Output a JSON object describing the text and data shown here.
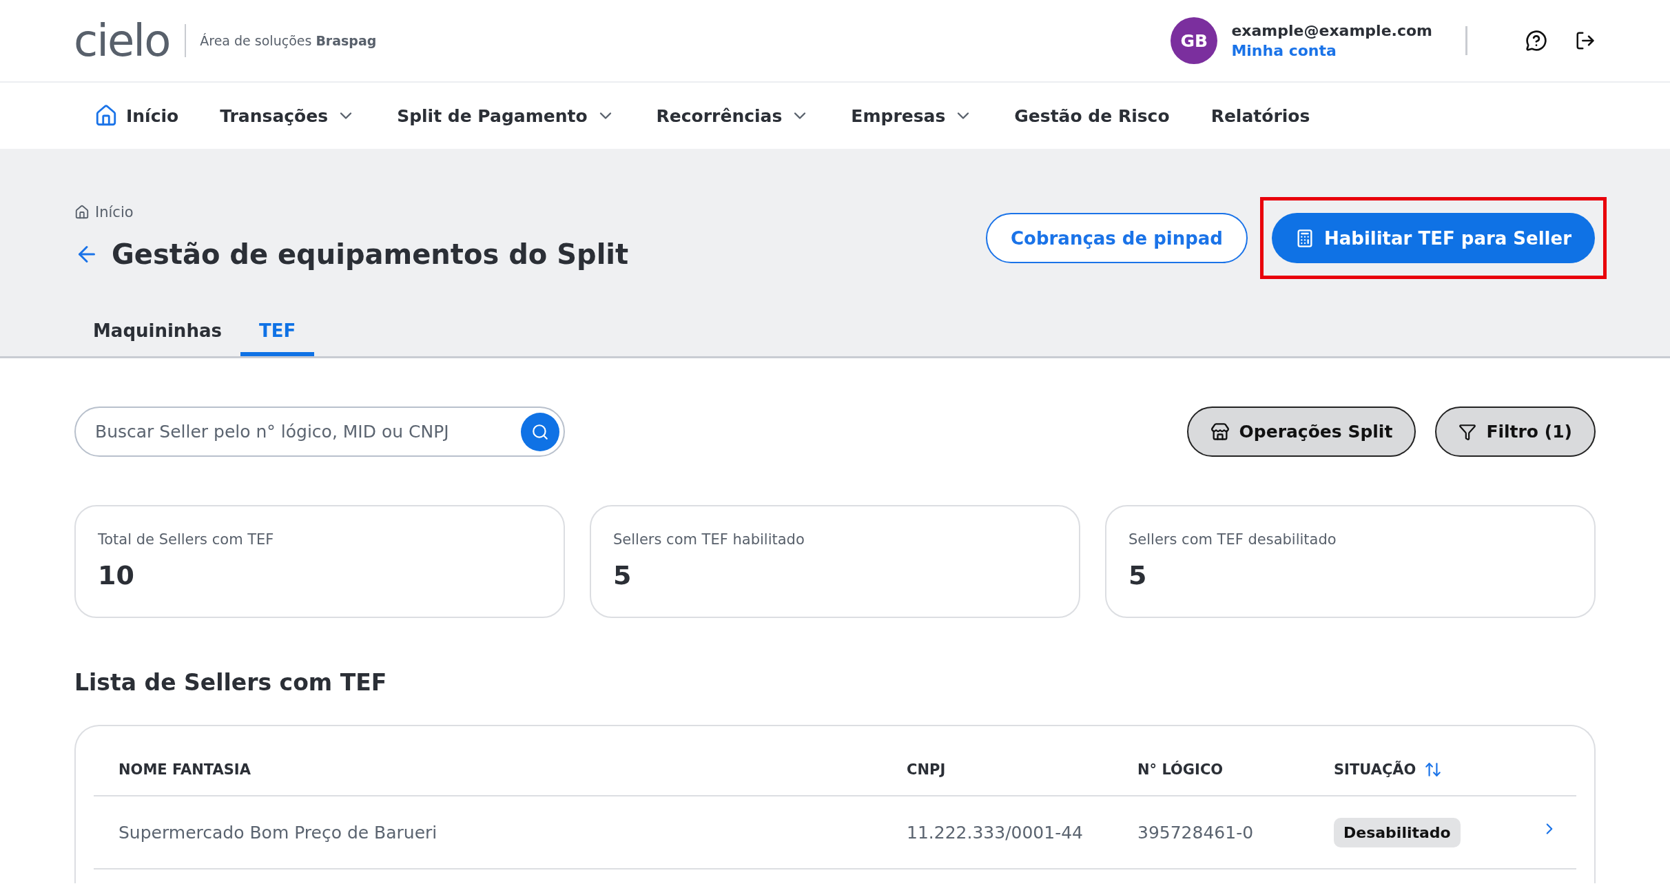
{
  "header": {
    "logo": "cielo",
    "subtitle": "Área de soluções **Braspag**",
    "user": {
      "initials": "GB",
      "email": "example@example.com",
      "account_link": "Minha conta"
    }
  },
  "nav": [
    {
      "label": "Início",
      "kind": "home",
      "selected": false
    },
    {
      "label": "Transações",
      "kind": "dropdown",
      "selected": false
    },
    {
      "label": "Split de Pagamento",
      "kind": "dropdown",
      "selected": false
    },
    {
      "label": "Recorrências",
      "kind": "dropdown",
      "selected": false
    },
    {
      "label": "Empresas",
      "kind": "dropdown",
      "selected": false
    },
    {
      "label": "Gestão de Risco",
      "kind": "plain",
      "selected": false
    },
    {
      "label": "Relatórios",
      "kind": "plain",
      "selected": false
    }
  ],
  "breadcrumb": "Início",
  "title": "Gestão de equipamentos do Split",
  "actions": [
    {
      "label": "Cobranças de pinpad",
      "kind": "outline",
      "highlighted": false
    },
    {
      "label": "Habilitar TEF para Seller",
      "kind": "primary",
      "highlighted": true
    }
  ],
  "tabs": [
    {
      "label": "Maquininhas",
      "selected": false
    },
    {
      "label": "TEF",
      "selected": true
    }
  ],
  "search": {
    "placeholder": "Buscar Seller pelo n° lógico, MID ou CNPJ"
  },
  "toolbar": [
    {
      "label": "Operações Split",
      "kind": "store"
    },
    {
      "label": "Filtro (1)",
      "kind": "filter"
    }
  ],
  "stats": [
    {
      "label": "Total de Sellers com TEF",
      "value": "10"
    },
    {
      "label": "Sellers com TEF habilitado",
      "value": "5"
    },
    {
      "label": "Sellers com TEF desabilitado",
      "value": "5"
    }
  ],
  "table": {
    "title": "Lista de Sellers com TEF",
    "columns": [
      {
        "label": "NOME FANTASIA",
        "sortable": false
      },
      {
        "label": "CNPJ",
        "sortable": false
      },
      {
        "label": "N° LÓGICO",
        "sortable": false
      },
      {
        "label": "SITUAÇÃO",
        "sortable": true
      }
    ],
    "rows": [
      {
        "name": "Supermercado Bom Preço de Barueri",
        "cnpj": "11.222.333/0001-44",
        "logic": "395728461-0",
        "status": "Desabilitado"
      }
    ]
  }
}
